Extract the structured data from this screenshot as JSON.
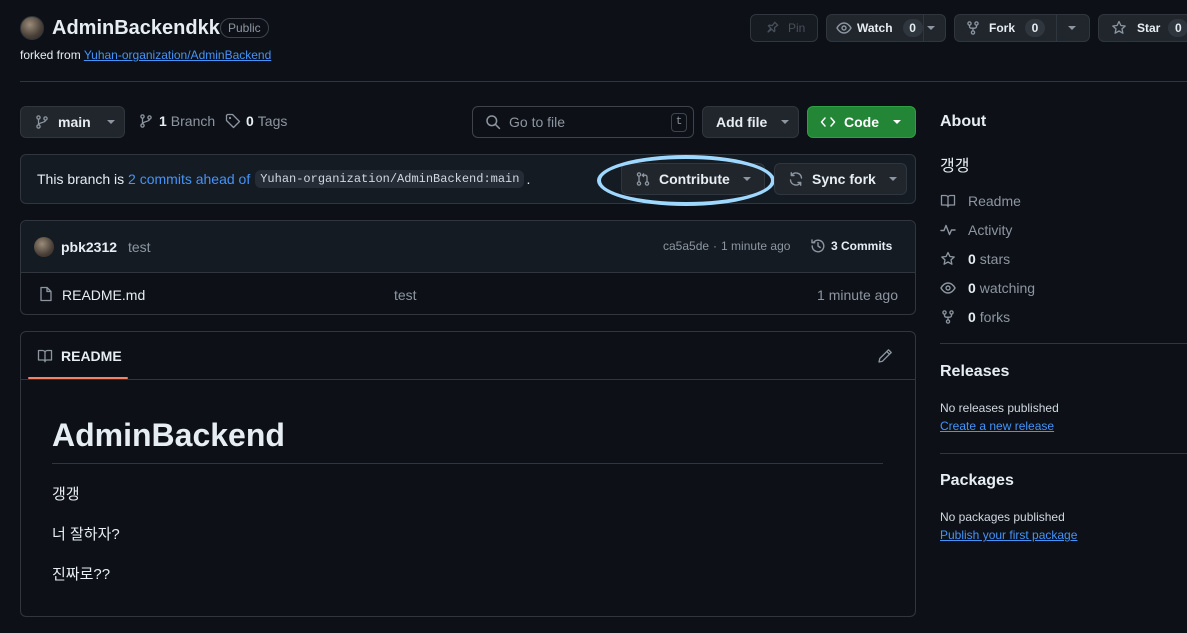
{
  "repo": {
    "name": "AdminBackendkk",
    "visibility": "Public",
    "forked_prefix": "forked from ",
    "forked_from": "Yuhan-organization/AdminBackend"
  },
  "actions": {
    "pin": "Pin",
    "watch": "Watch",
    "watch_count": "0",
    "fork": "Fork",
    "fork_count": "0",
    "star": "Star",
    "star_count": "0"
  },
  "toolbar": {
    "branch": "main",
    "branch_count": "1",
    "branch_label": "Branch",
    "tag_count": "0",
    "tag_label": "Tags",
    "search_placeholder": "Go to file",
    "search_key": "t",
    "add_file": "Add file",
    "code": "Code"
  },
  "ahead": {
    "prefix": "This branch is ",
    "link": "2 commits ahead of",
    "ref": "Yuhan-organization/AdminBackend:main",
    "suffix": ".",
    "contribute": "Contribute",
    "sync": "Sync fork"
  },
  "commit": {
    "author": "pbk2312",
    "message": "test",
    "hash": "ca5a5de",
    "sep": "·",
    "time": "1 minute ago",
    "count": "3 Commits"
  },
  "files": [
    {
      "name": "README.md",
      "message": "test",
      "time": "1 minute ago"
    }
  ],
  "readme": {
    "tab": "README",
    "title": "AdminBackend",
    "lines": [
      "갱갱",
      "너 잘하자?",
      "진짜로??"
    ]
  },
  "about": {
    "heading": "About",
    "description": "갱갱",
    "readme": "Readme",
    "activity": "Activity",
    "stars_count": "0",
    "stars_label": "stars",
    "watching_count": "0",
    "watching_label": "watching",
    "forks_count": "0",
    "forks_label": "forks"
  },
  "releases": {
    "heading": "Releases",
    "empty": "No releases published",
    "link": "Create a new release"
  },
  "packages": {
    "heading": "Packages",
    "empty": "No packages published",
    "link": "Publish your first package"
  },
  "colors": {
    "background": "#0d1117",
    "accent_link": "#4493f8",
    "code_button": "#238636",
    "highlight_ring": "#9fd8ff",
    "tab_underline": "#f78166"
  },
  "icons": [
    "avatar",
    "pin-icon",
    "eye-icon",
    "fork-icon",
    "star-icon",
    "branch-icon",
    "tag-icon",
    "search-icon",
    "code-icon",
    "pull-request-icon",
    "sync-icon",
    "history-icon",
    "file-icon",
    "book-icon",
    "pencil-icon",
    "pulse-icon"
  ]
}
